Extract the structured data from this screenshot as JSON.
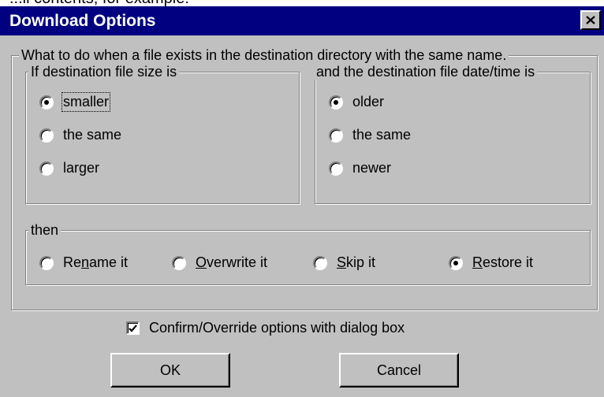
{
  "top_strip_text": "...ll contents, for example:",
  "window": {
    "title": "Download Options"
  },
  "main_group": {
    "legend": "What to do when a file exists in the destination directory with the same name.",
    "size_group": {
      "legend": "If destination file size is",
      "options": [
        {
          "label": "smaller",
          "checked": true
        },
        {
          "label": "the same",
          "checked": false
        },
        {
          "label": "larger",
          "checked": false
        }
      ]
    },
    "date_group": {
      "legend": "and the destination file date/time is",
      "options": [
        {
          "label": "older",
          "checked": true
        },
        {
          "label": "the same",
          "checked": false
        },
        {
          "label": "newer",
          "checked": false
        }
      ]
    },
    "then_group": {
      "legend": "then",
      "options": [
        {
          "pre": "Re",
          "key": "n",
          "post": "ame it",
          "checked": false
        },
        {
          "pre": "",
          "key": "O",
          "post": "verwrite it",
          "checked": false
        },
        {
          "pre": "",
          "key": "S",
          "post": "kip it",
          "checked": false
        },
        {
          "pre": "",
          "key": "R",
          "post": "estore it",
          "checked": true
        }
      ]
    }
  },
  "confirm": {
    "label": "Confirm/Override options with dialog box",
    "checked": true
  },
  "buttons": {
    "ok": "OK",
    "cancel": "Cancel"
  }
}
